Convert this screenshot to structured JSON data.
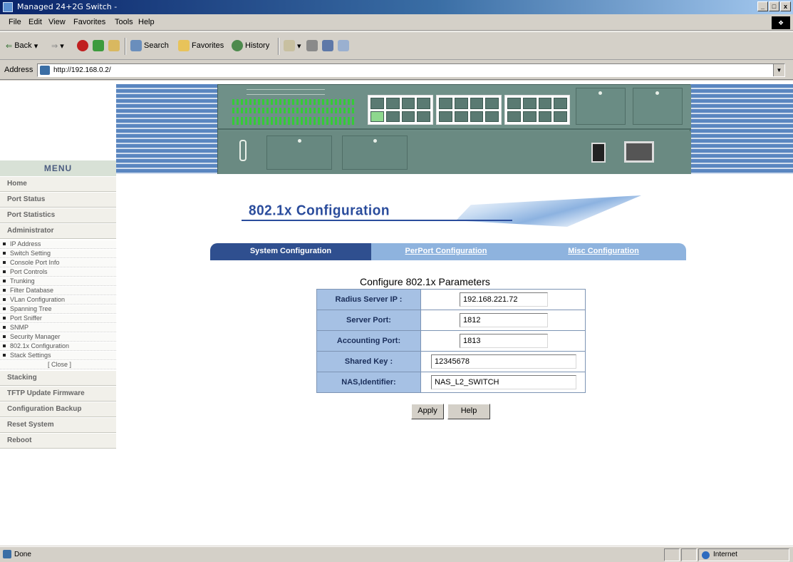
{
  "window": {
    "title": "Managed 24+2G Switch -",
    "controls": [
      "_",
      "□",
      "x"
    ]
  },
  "menubar": [
    "File",
    "Edit",
    "View",
    "Favorites",
    "Tools",
    "Help"
  ],
  "toolbar": {
    "back": "Back",
    "search": "Search",
    "favorites": "Favorites",
    "history": "History"
  },
  "address": {
    "label": "Address",
    "url": "http://192.168.0.2/"
  },
  "sidebar": {
    "menu_title": "MENU",
    "items_top": [
      "Home",
      "Port Status",
      "Port Statistics",
      "Administrator"
    ],
    "admin_sub": [
      "IP Address",
      "Switch Setting",
      "Console Port Info",
      "Port Controls",
      "Trunking",
      "Filter Database",
      "VLan Configuration",
      "Spanning Tree",
      "Port Sniffer",
      "SNMP",
      "Security Manager",
      "802.1x Configuration",
      "Stack Settings"
    ],
    "close": "[ Close ]",
    "items_bottom": [
      "Stacking",
      "TFTP Update Firmware",
      "Configuration Backup",
      "Reset System",
      "Reboot"
    ]
  },
  "page": {
    "title": "802.1x Configuration",
    "tabs": [
      "System Configuration",
      "PerPort Configuration",
      "Misc Configuration"
    ],
    "form_title": "Configure 802.1x Parameters",
    "fields": [
      {
        "label": "Radius Server IP :",
        "value": "192.168.221.72"
      },
      {
        "label": "Server Port:",
        "value": "1812"
      },
      {
        "label": "Accounting Port:",
        "value": "1813"
      },
      {
        "label": "Shared Key :",
        "value": "12345678"
      },
      {
        "label": "NAS,Identifier:",
        "value": "NAS_L2_SWITCH"
      }
    ],
    "buttons": {
      "apply": "Apply",
      "help": "Help"
    }
  },
  "status": {
    "text": "Done",
    "zone": "Internet"
  }
}
